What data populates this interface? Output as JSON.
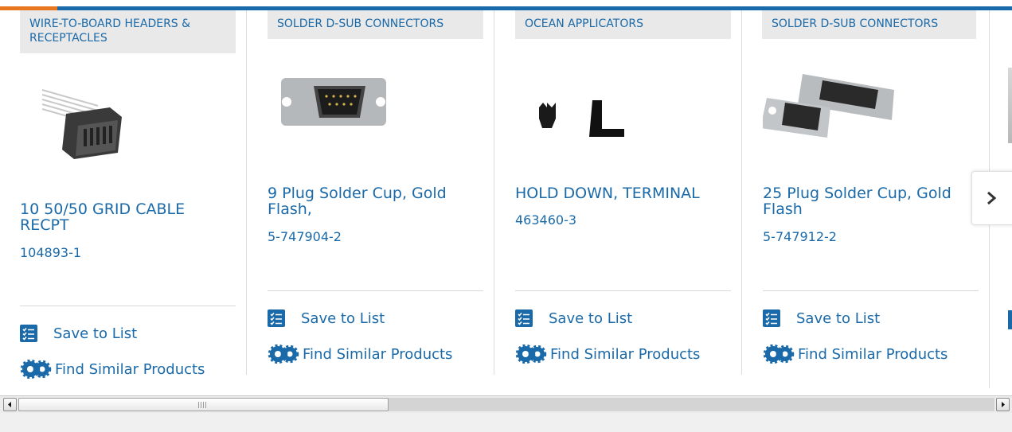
{
  "products": [
    {
      "category": "SOLDER D-SUB CONNECTORS",
      "name": "9 Plug Solder Cup, Gold Flash,",
      "part_number": "5-747904-2",
      "save_label": "Save to List",
      "similar_label": "Find Similar Products",
      "image": "9-pin-d-sub-connector"
    },
    {
      "category": "OCEAN APPLICATORS",
      "name": "HOLD DOWN, TERMINAL",
      "part_number": "463460-3",
      "save_label": "Save to List",
      "similar_label": "Find Similar Products",
      "image": "hold-down-terminal"
    },
    {
      "category": "SOLDER D-SUB CONNECTORS",
      "name": "25 Plug Solder Cup, Gold Flash",
      "part_number": "5-747912-2",
      "save_label": "Save to List",
      "similar_label": "Find Similar Products",
      "image": "25-pin-d-sub-connector"
    },
    {
      "category": "WIRE-TO-BOARD HEADERS & RECEPTACLES",
      "name": "10 50/50 GRID CABLE RECPT",
      "part_number": "104893-1",
      "save_label": "Save to List",
      "similar_label": "Find Similar Products",
      "image": "ribbon-cable-receptacle"
    }
  ],
  "carousel": {
    "next_icon": "chevron-right-icon"
  },
  "colors": {
    "link": "#1a69a8",
    "accent": "#e87722",
    "category_bg": "#e9e9e9"
  }
}
